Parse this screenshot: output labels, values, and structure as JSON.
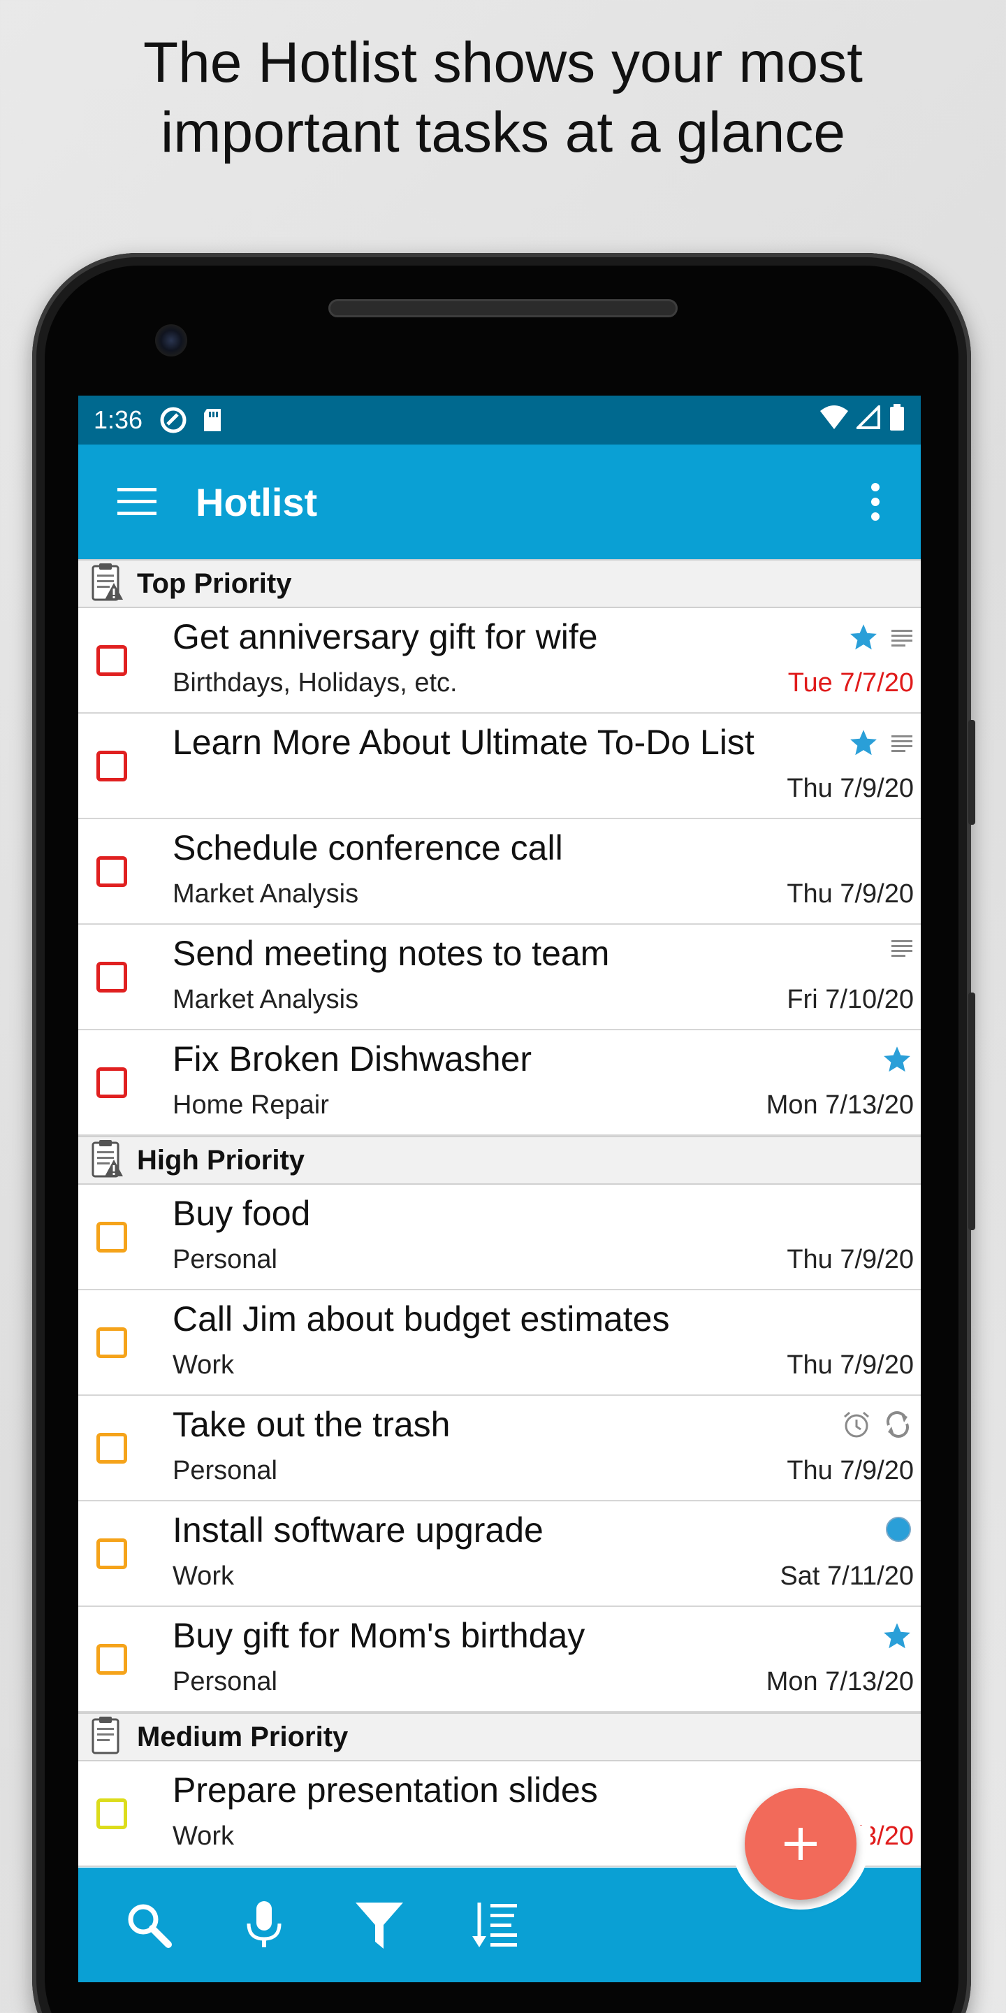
{
  "headline": {
    "line1": "The Hotlist shows your most",
    "line2": "important tasks at a glance"
  },
  "status_bar": {
    "time": "1:36",
    "icons": [
      "sync-icon",
      "sd-card-icon",
      "wifi-icon",
      "signal-icon",
      "battery-icon"
    ]
  },
  "app_bar": {
    "title": "Hotlist",
    "menu_icon": "hamburger-menu-icon",
    "overflow_icon": "more-vert-icon",
    "color": "#0aa0d4"
  },
  "sections": [
    {
      "title": "Top Priority",
      "priority": "top",
      "tasks": [
        {
          "title": "Get anniversary gift for wife",
          "category": "Birthdays, Holidays, etc.",
          "date": "Tue 7/7/20",
          "overdue": true,
          "icons": [
            "star",
            "note"
          ]
        },
        {
          "title": "Learn More About Ultimate To-Do List",
          "category": "",
          "date": "Thu 7/9/20",
          "overdue": false,
          "icons": [
            "star",
            "note"
          ]
        },
        {
          "title": "Schedule conference call",
          "category": "Market Analysis",
          "date": "Thu 7/9/20",
          "overdue": false,
          "icons": []
        },
        {
          "title": "Send meeting notes to team",
          "category": "Market Analysis",
          "date": "Fri 7/10/20",
          "overdue": false,
          "icons": [
            "note"
          ]
        },
        {
          "title": "Fix Broken Dishwasher",
          "category": "Home Repair",
          "date": "Mon 7/13/20",
          "overdue": false,
          "icons": [
            "star"
          ]
        }
      ]
    },
    {
      "title": "High Priority",
      "priority": "high",
      "tasks": [
        {
          "title": "Buy food",
          "category": "Personal",
          "date": "Thu 7/9/20",
          "overdue": false,
          "icons": []
        },
        {
          "title": "Call Jim about budget estimates",
          "category": "Work",
          "date": "Thu 7/9/20",
          "overdue": false,
          "icons": []
        },
        {
          "title": "Take out the trash",
          "category": "Personal",
          "date": "Thu 7/9/20",
          "overdue": false,
          "icons": [
            "alarm",
            "repeat"
          ]
        },
        {
          "title": "Install software upgrade",
          "category": "Work",
          "date": "Sat 7/11/20",
          "overdue": false,
          "icons": [
            "dot"
          ]
        },
        {
          "title": "Buy gift for Mom's birthday",
          "category": "Personal",
          "date": "Mon 7/13/20",
          "overdue": false,
          "icons": [
            "star"
          ]
        }
      ]
    },
    {
      "title": "Medium Priority",
      "priority": "medium",
      "tasks": [
        {
          "title": "Prepare presentation slides",
          "category": "Work",
          "date": "/3/20",
          "overdue": true,
          "icons": []
        }
      ]
    }
  ],
  "bottom_bar": {
    "buttons": [
      "search-icon",
      "microphone-icon",
      "filter-icon",
      "sort-icon"
    ]
  },
  "fab": {
    "icon": "plus-icon",
    "color": "#f26a5a"
  },
  "colors": {
    "status_bar": "#00698f",
    "accent": "#0aa0d4",
    "overdue": "#e01b1b",
    "star": "#2a9fd8",
    "top_priority": "#e02020",
    "high_priority": "#f5a31a",
    "medium_priority": "#dcdc1c"
  }
}
